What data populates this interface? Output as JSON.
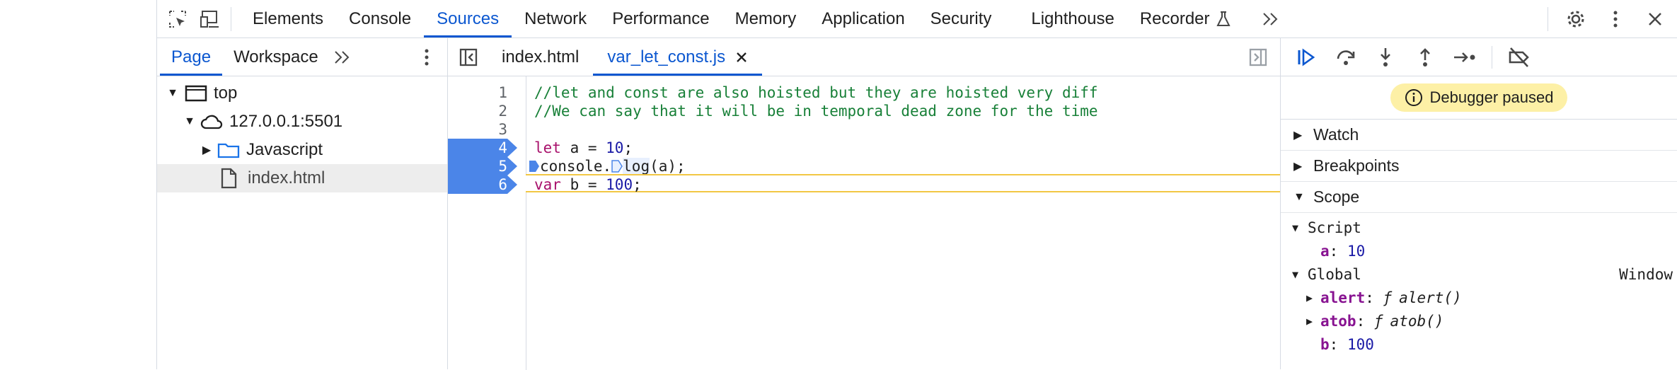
{
  "main_tabs": [
    "Elements",
    "Console",
    "Sources",
    "Network",
    "Performance",
    "Memory",
    "Application",
    "Security",
    "Lighthouse",
    "Recorder"
  ],
  "active_main_tab": "Sources",
  "navigator": {
    "tabs": [
      "Page",
      "Workspace"
    ],
    "tree": {
      "top": "top",
      "host": "127.0.0.1:5501",
      "folder": "Javascript",
      "file": "index.html"
    }
  },
  "editor": {
    "tabs": [
      "index.html",
      "var_let_const.js"
    ],
    "lines": [
      {
        "n": "1",
        "text": "//let and const are also hoisted but they are hoisted very diff"
      },
      {
        "n": "2",
        "text": "//We can say that it will be in temporal dead zone for the time"
      },
      {
        "n": "3",
        "text": ""
      },
      {
        "n": "4",
        "kw": "let",
        "rest": " a = ",
        "num": "10",
        "end": ";"
      },
      {
        "n": "5",
        "pre": "console.",
        "mid": "log",
        "end": "(a);"
      },
      {
        "n": "6",
        "kw": "var",
        "rest": " b = ",
        "num": "100",
        "end": ";"
      }
    ]
  },
  "debugger": {
    "paused_label": "Debugger paused",
    "sections": {
      "watch": "Watch",
      "breakpoints": "Breakpoints",
      "scope": "Scope"
    },
    "scope": {
      "script_label": "Script",
      "script_var": {
        "name": "a",
        "value": "10"
      },
      "global_label": "Global",
      "global_value": "Window",
      "globals": [
        {
          "name": "alert",
          "prefix": "ƒ",
          "value": "alert()"
        },
        {
          "name": "atob",
          "prefix": "ƒ",
          "value": "atob()"
        },
        {
          "name": "b",
          "value": "100"
        }
      ]
    }
  },
  "colors": {
    "accent": "#0b57d0",
    "breakpoint": "#4b85e8",
    "paused_bg": "#fdf0a6",
    "exec_line": "#f2c744"
  }
}
